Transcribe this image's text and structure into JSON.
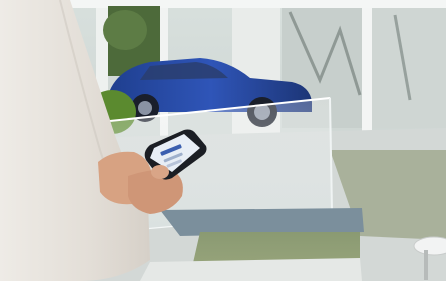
{
  "photo": {
    "description_icon": "photo-icon"
  }
}
